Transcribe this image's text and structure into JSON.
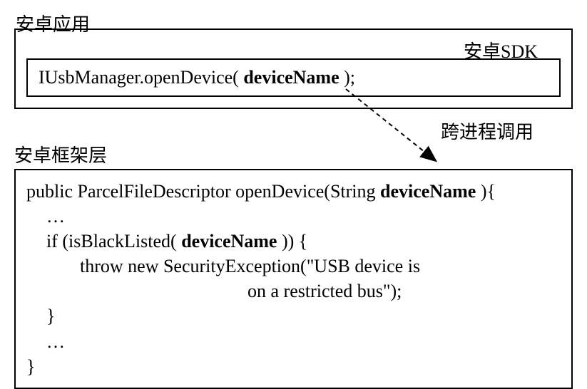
{
  "appLabel": "安卓应用",
  "sdkLabel": "安卓SDK",
  "sdkCode": {
    "prefix": "IUsbManager.openDevice( ",
    "param": "deviceName",
    "suffix": " );"
  },
  "ipcLabel": "跨进程调用",
  "frameworkLabel": "安卓框架层",
  "frameworkCode": {
    "line1_prefix": "public ParcelFileDescriptor openDevice(String ",
    "line1_param": "deviceName",
    "line1_suffix": " ){",
    "line2": "…",
    "line3_prefix": "if (isBlackListed( ",
    "line3_param": "deviceName",
    "line3_suffix": " )) {",
    "line4": "throw new SecurityException(\"USB device is",
    "line5": "on a restricted bus\");",
    "line6": "}",
    "line7": "…",
    "line8": "}"
  }
}
